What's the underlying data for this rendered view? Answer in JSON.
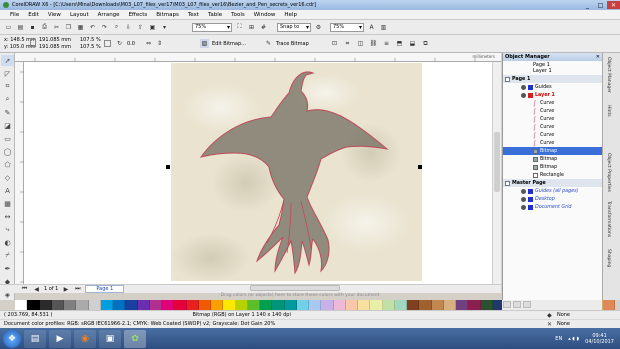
{
  "window": {
    "title": "CorelDRAW X6 - [C:\\Users\\Mina\\Downloads\\M03_L07_files_ver17\\M03_L07_files_ver16\\Bezier_and_Pen_secrets_ver16.cdr]",
    "controls": [
      "_",
      "□",
      "✕"
    ]
  },
  "menu": [
    "File",
    "Edit",
    "View",
    "Layout",
    "Arrange",
    "Effects",
    "Bitmaps",
    "Text",
    "Table",
    "Tools",
    "Window",
    "Help"
  ],
  "toolbar_standard": {
    "zoom_value": "75%",
    "snap_to": "Snap to",
    "zoom_value2": "75%"
  },
  "property_bar": {
    "x": "x: 148.5 mm",
    "y": "y: 105.0 mm",
    "w": "191.085 mm",
    "h": "191.085 mm",
    "sx": "107.5",
    "sy": "107.5",
    "pct": "%",
    "angle": "0.0",
    "edit_bitmap": "Edit Bitmap...",
    "trace_bitmap": "Trace Bitmap"
  },
  "ruler_unit": "millimeters",
  "page_nav": {
    "counter": "1 of 1",
    "tab": "Page 1"
  },
  "hint": "Drag colors (or objects) here to store these colors with your document",
  "status": {
    "coords": "( 203.769, 84.531 )",
    "object_info": "Bitmap (RGB) on Layer 1 140 x 140 dpi",
    "profiles": "Document color profiles: RGB: sRGB IEC61966-2.1; CMYK: Web Coated (SWOP) v2; Grayscale: Dot Gain 20%",
    "fill": "None",
    "outline": "None"
  },
  "object_manager": {
    "title": "Object Manager",
    "header_page": "Page 1",
    "header_layer": "Layer 1",
    "rows": [
      {
        "label": "Page 1",
        "kind": "page"
      },
      {
        "label": "Guides",
        "kind": "layer"
      },
      {
        "label": "Layer 1",
        "kind": "layer-red"
      },
      {
        "label": "Curve",
        "kind": "curve"
      },
      {
        "label": "Curve",
        "kind": "curve"
      },
      {
        "label": "Curve",
        "kind": "curve"
      },
      {
        "label": "Curve",
        "kind": "curve"
      },
      {
        "label": "Curve",
        "kind": "curve"
      },
      {
        "label": "Curve",
        "kind": "curve"
      },
      {
        "label": "Bitmap",
        "kind": "bitmap-selected"
      },
      {
        "label": "Bitmap",
        "kind": "bitmap"
      },
      {
        "label": "Bitmap",
        "kind": "bitmap"
      },
      {
        "label": "Rectangle",
        "kind": "rect"
      },
      {
        "label": "Master Page",
        "kind": "page"
      },
      {
        "label": "Guides (all pages)",
        "kind": "master"
      },
      {
        "label": "Desktop",
        "kind": "master"
      },
      {
        "label": "Document Grid",
        "kind": "master"
      }
    ]
  },
  "side_tabs": [
    "Object Manager",
    "Hints",
    "Object Properties",
    "Transformations",
    "Shaping"
  ],
  "palette": [
    "#ffffff",
    "#000000",
    "#2a2a2a",
    "#555555",
    "#808080",
    "#aaaaaa",
    "#d0d0d0",
    "#00a0e0",
    "#0070c0",
    "#1a3fa0",
    "#6a2fb0",
    "#b0308f",
    "#e0007a",
    "#e4003a",
    "#e82020",
    "#f05a00",
    "#f7a000",
    "#fde800",
    "#b8d200",
    "#5cbf2a",
    "#00a050",
    "#00957a",
    "#009aa0",
    "#6fd0e8",
    "#a8c8f0",
    "#c8b0e8",
    "#f0b8d8",
    "#f8c8a8",
    "#fae0a0",
    "#e8f0a8",
    "#c0e0a8",
    "#a0d8c0",
    "#804020",
    "#a06030",
    "#c08850",
    "#d8b080",
    "#704080",
    "#8a2050",
    "#2a5030",
    "#203870",
    "#404040",
    "#606060",
    "#7a7a7a",
    "#9a9a9a",
    "#b5b5b5",
    "#cfcfcf",
    "#e6e6e6",
    "#f0d080",
    "#e08858"
  ],
  "taskbar": {
    "lang": "EN",
    "time": "09:41",
    "date": "04/10/2017"
  }
}
